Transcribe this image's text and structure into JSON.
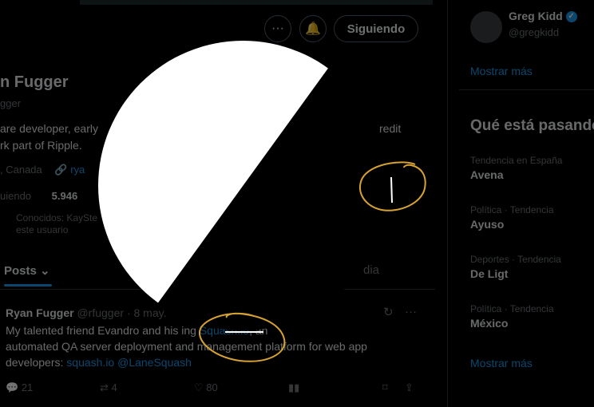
{
  "profile": {
    "name_partial": "n Fugger",
    "handle_partial": "gger",
    "bio_line1": "are developer, early",
    "bio_line1_right": "redit",
    "bio_line2": "rk part of Ripple.",
    "location_partial": ", Canada",
    "website_partial": "rya",
    "following_label": "uiendo",
    "followers_count": "5.946",
    "known_followers": "Conocidos: KaySte",
    "known_followers_2": "este usuario",
    "follow_button": "Siguiendo"
  },
  "tabs": {
    "posts": "Posts",
    "media_partial": "dia"
  },
  "tweet": {
    "author": "Ryan Fugger",
    "handle": "@rfugger",
    "date": "8 may.",
    "text_line1_start": "My talented friend Evandro and his",
    "text_line1_mid": "ing",
    "text_link1": "Squash.io",
    "text_line1_end": ", an",
    "text_line2": "automated QA server deployment and management platform for web app",
    "text_line3_start": "developers:",
    "text_link2": "squash.io @LaneSquash",
    "replies": "21",
    "reposts": "4",
    "likes": "80"
  },
  "sidebar": {
    "who_to_follow": {
      "name": "Greg Kidd",
      "handle": "@gregkidd"
    },
    "show_more_1": "Mostrar más",
    "trends_title": "Qué está pasando",
    "trends": [
      {
        "category": "Tendencia en España",
        "name": "Avena"
      },
      {
        "category": "Política · Tendencia",
        "name": "Ayuso"
      },
      {
        "category": "Deportes · Tendencia",
        "name": "De Ligt"
      },
      {
        "category": "Política · Tendencia",
        "name": "México"
      }
    ],
    "show_more_2": "Mostrar más"
  },
  "colors": {
    "accent": "#1d9bf0",
    "annotation": "#d6a233",
    "background": "#000000"
  }
}
